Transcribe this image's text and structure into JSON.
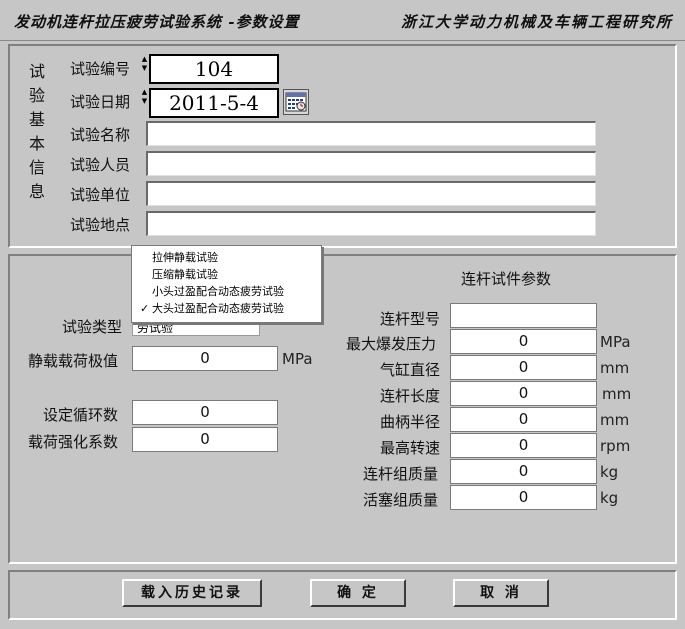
{
  "window": {
    "title_left": "发动机连杆拉压疲劳试验系统  -参数设置",
    "title_right": "浙江大学动力机械及车辆工程研究所"
  },
  "basic_info": {
    "group_label": [
      "试",
      "验",
      "基",
      "本",
      "信",
      "息"
    ],
    "fields": [
      {
        "label": "试验编号",
        "value": "104"
      },
      {
        "label": "试验日期",
        "value": "2011-5-4"
      },
      {
        "label": "试验名称",
        "value": ""
      },
      {
        "label": "试验人员",
        "value": ""
      },
      {
        "label": "试验单位",
        "value": ""
      },
      {
        "label": "试验地点",
        "value": ""
      }
    ],
    "calendar_icon": "calendar-icon"
  },
  "test_type": {
    "label": "试验类型",
    "selected_partial": "劳试验",
    "options": [
      "拉伸静载试验",
      "压缩静载试验",
      "小头过盈配合动态疲劳试验",
      "大头过盈配合动态疲劳试验"
    ],
    "checked_index": 3,
    "check_glyph": "✓"
  },
  "left_params": [
    {
      "label": "静载载荷极值",
      "value": "0",
      "unit": "MPa"
    },
    {
      "label": "设定循环数",
      "value": "0",
      "unit": ""
    },
    {
      "label": "载荷强化系数",
      "value": "0",
      "unit": ""
    }
  ],
  "rod_params": {
    "title": "连杆试件参数",
    "items": [
      {
        "label": "连杆型号",
        "value": "",
        "unit": ""
      },
      {
        "label": "最大爆发压力",
        "value": "0",
        "unit": "MPa"
      },
      {
        "label": "气缸直径",
        "value": "0",
        "unit": "mm"
      },
      {
        "label": "连杆长度",
        "value": "0",
        "unit": "mm"
      },
      {
        "label": "曲柄半径",
        "value": "0",
        "unit": "mm"
      },
      {
        "label": "最高转速",
        "value": "0",
        "unit": "rpm"
      },
      {
        "label": "连杆组质量",
        "value": "0",
        "unit": "kg"
      },
      {
        "label": "活塞组质量",
        "value": "0",
        "unit": "kg"
      }
    ]
  },
  "buttons": {
    "load_history": "载入历史记录",
    "confirm": "确 定",
    "cancel": "取 消"
  },
  "spinner": {
    "up": "▲",
    "down": "▼"
  }
}
